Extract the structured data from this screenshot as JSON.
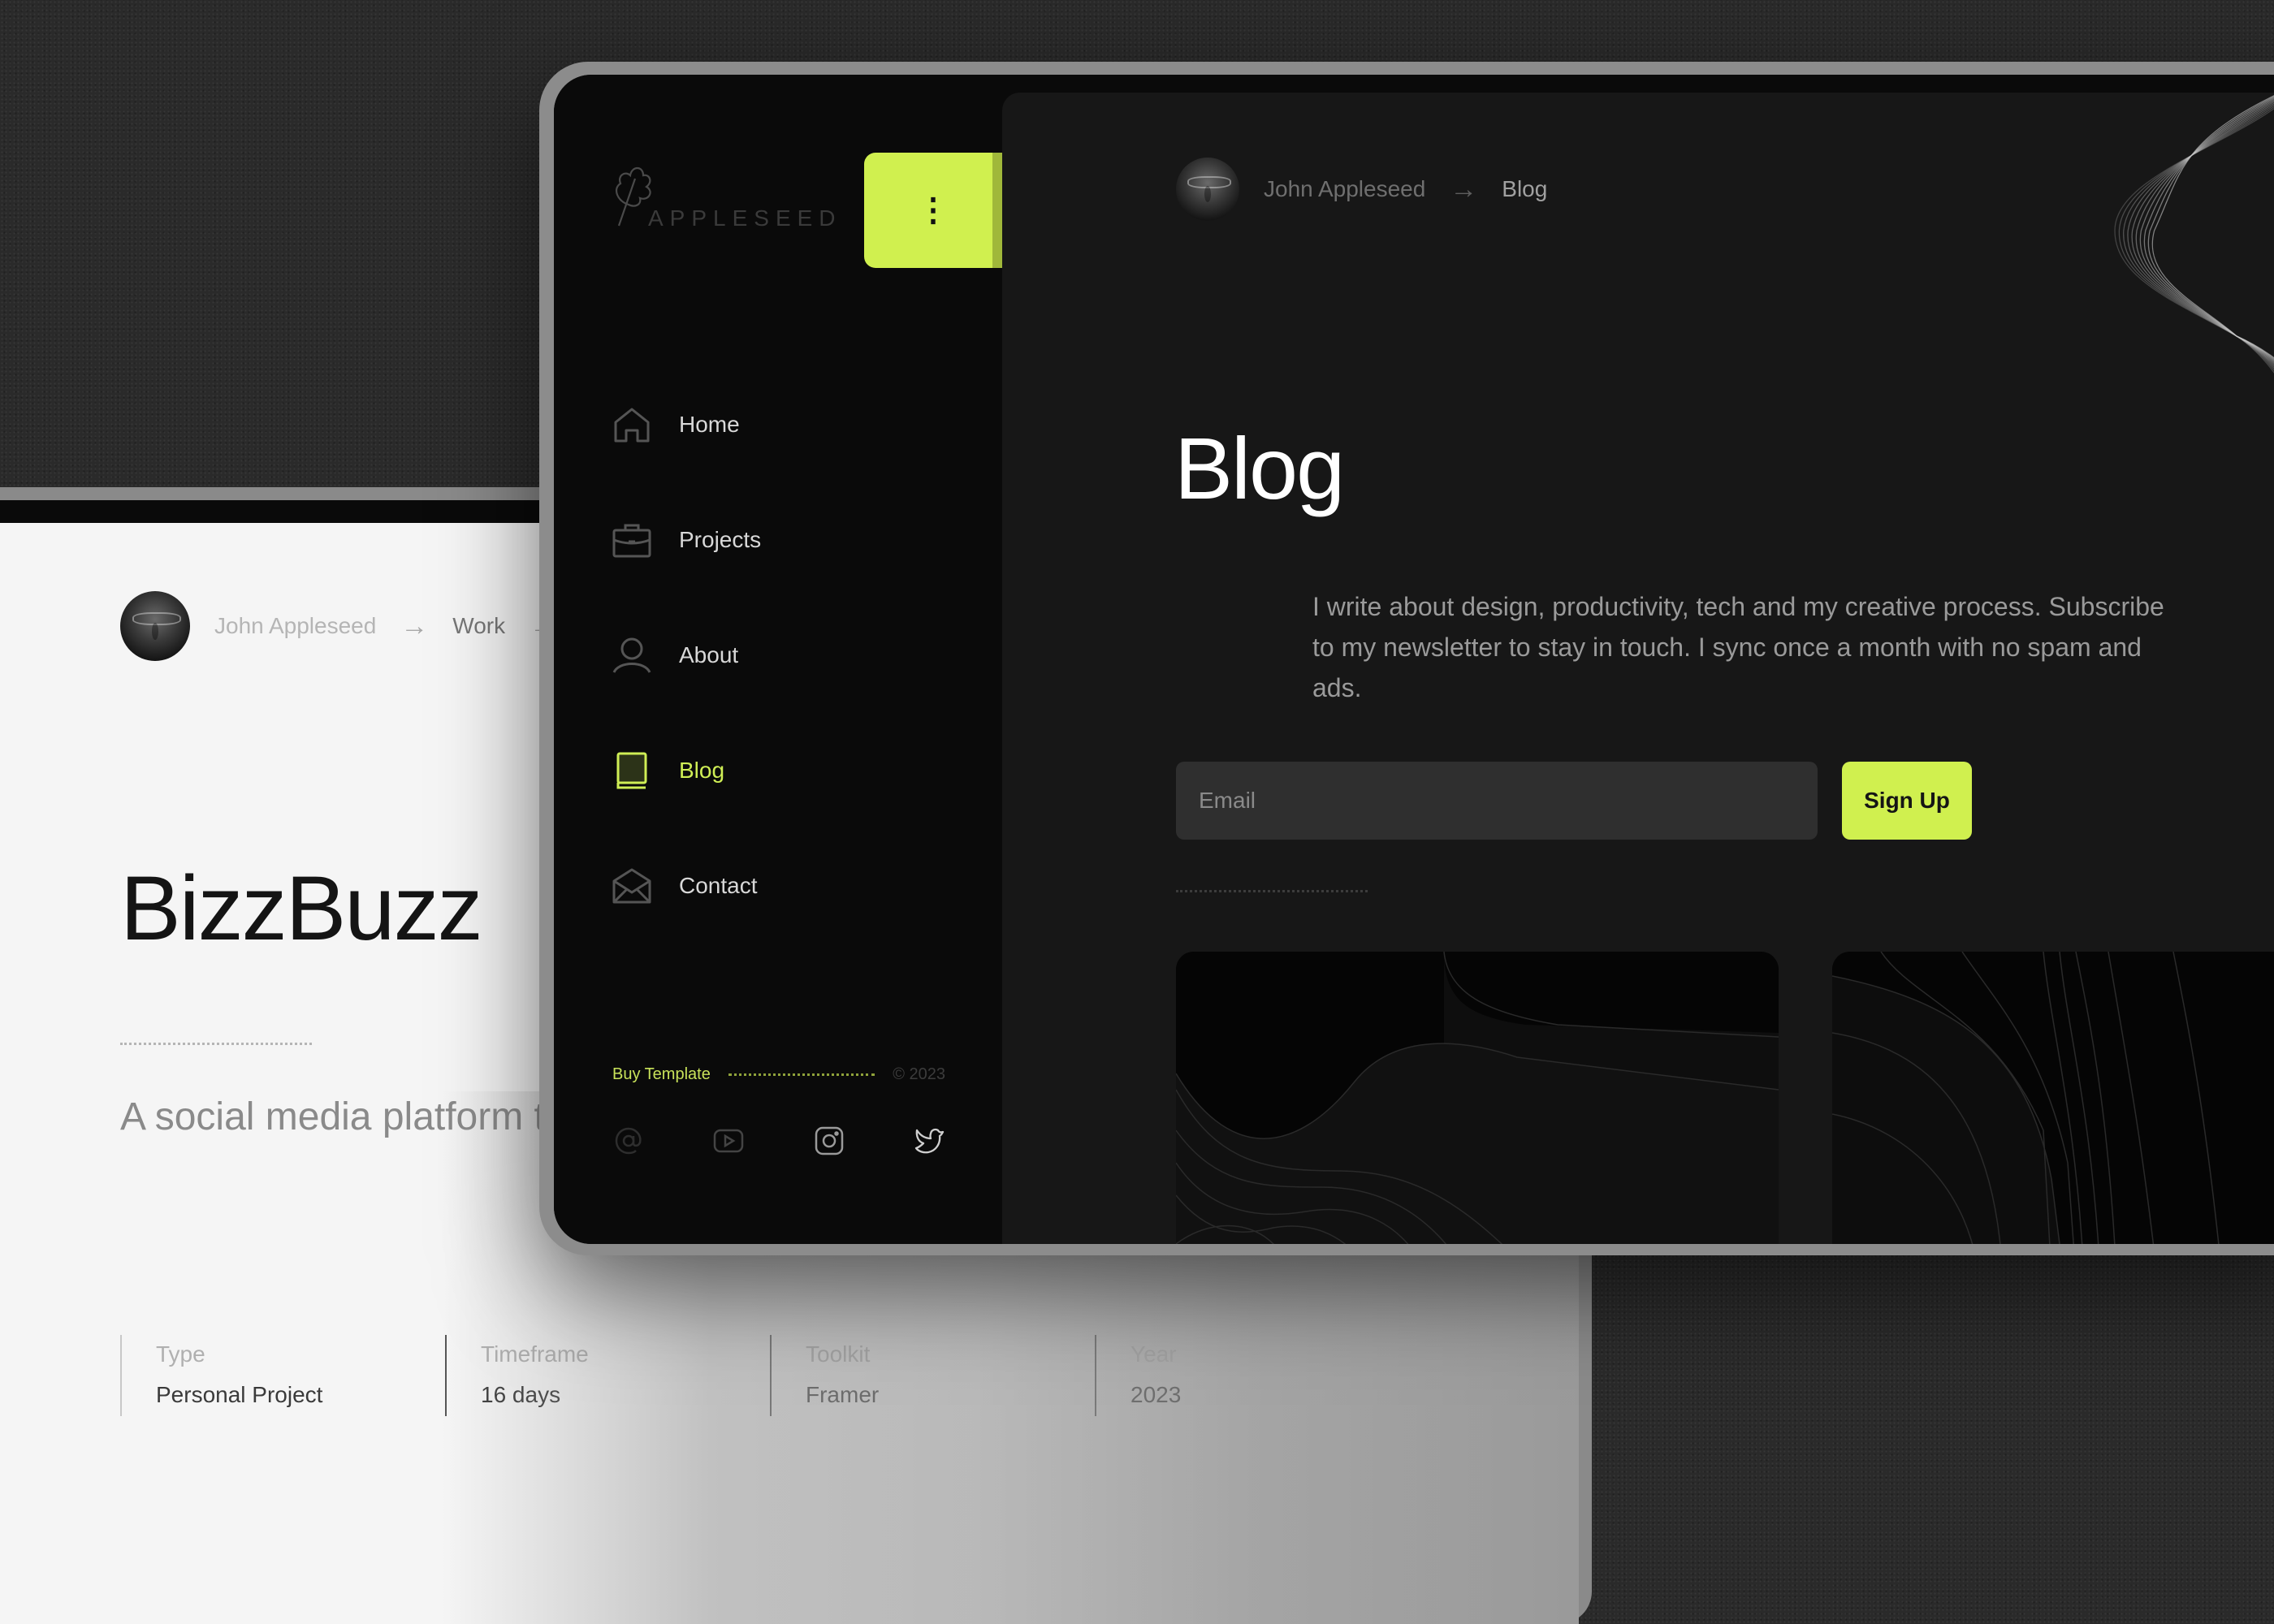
{
  "back_page": {
    "breadcrumb": {
      "name": "John Appleseed",
      "arrow": "→",
      "current": "Work",
      "trailing": "→"
    },
    "title": "BizzBuzz",
    "description": "A social media platform to network and collaborate",
    "meta": [
      {
        "label": "Type",
        "value": "Personal Project"
      },
      {
        "label": "Timeframe",
        "value": "16 days"
      },
      {
        "label": "Toolkit",
        "value": "Framer"
      },
      {
        "label": "Year",
        "value": "2023"
      }
    ]
  },
  "sidebar": {
    "logo_text": "APPLESEED",
    "menu_icon": "⋮",
    "nav": [
      {
        "label": "Home",
        "icon": "home-icon",
        "active": false
      },
      {
        "label": "Projects",
        "icon": "briefcase-icon",
        "active": false
      },
      {
        "label": "About",
        "icon": "user-icon",
        "active": false
      },
      {
        "label": "Blog",
        "icon": "book-icon",
        "active": true
      },
      {
        "label": "Contact",
        "icon": "mail-icon",
        "active": false
      }
    ],
    "footer": {
      "buy_label": "Buy Template",
      "copyright": "© 2023"
    },
    "socials": [
      "at-icon",
      "youtube-icon",
      "instagram-icon",
      "twitter-icon"
    ]
  },
  "main": {
    "breadcrumb": {
      "name": "John Appleseed",
      "arrow": "→",
      "current": "Blog"
    },
    "title": "Blog",
    "intro": "I write about design, productivity, tech and my creative process. Subscribe to my newsletter to stay in touch. I sync once a month with no spam and ads.",
    "email_placeholder": "Email",
    "email_value": "",
    "signup_label": "Sign Up"
  },
  "colors": {
    "accent": "#d0f04f",
    "panel": "#171717",
    "sidebar": "#0a0a0a"
  }
}
